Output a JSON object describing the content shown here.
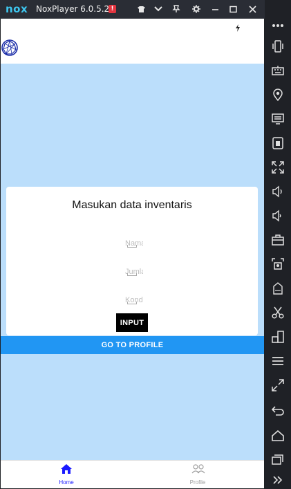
{
  "window": {
    "logo_text": "nox",
    "title": "NoxPlayer 6.0.5.2",
    "alert_badge": "!"
  },
  "titlebar_buttons": [
    {
      "name": "theme-icon"
    },
    {
      "name": "chevron-down-icon"
    },
    {
      "name": "pin-icon"
    },
    {
      "name": "gear-icon"
    },
    {
      "name": "minimize-icon"
    },
    {
      "name": "maximize-icon"
    },
    {
      "name": "close-icon"
    }
  ],
  "sidebar_buttons": [
    {
      "name": "more-icon"
    },
    {
      "name": "shake-icon"
    },
    {
      "name": "keyboard-icon"
    },
    {
      "name": "location-icon"
    },
    {
      "name": "screen-icon"
    },
    {
      "name": "apk-install-icon"
    },
    {
      "name": "fullscreen-icon"
    },
    {
      "name": "volume-up-icon"
    },
    {
      "name": "volume-down-icon"
    },
    {
      "name": "toolbox-icon"
    },
    {
      "name": "screenshot-icon"
    },
    {
      "name": "fps-icon"
    },
    {
      "name": "scissors-icon"
    },
    {
      "name": "multi-instance-icon"
    },
    {
      "name": "menu-icon"
    },
    {
      "name": "resize-icon"
    },
    {
      "name": "back-icon"
    },
    {
      "name": "home-icon"
    },
    {
      "name": "recent-apps-icon"
    },
    {
      "name": "expand-icon"
    }
  ],
  "form": {
    "title": "Masukan data inventaris",
    "fields": [
      {
        "placeholder": "Nama",
        "value": ""
      },
      {
        "placeholder": "Jumlah",
        "value": ""
      },
      {
        "placeholder": "Kondisi",
        "value": ""
      }
    ],
    "submit_label": "INPUT"
  },
  "profile_button": "GO TO PROFILE",
  "tabs": [
    {
      "label": "Home",
      "active": true
    },
    {
      "label": "Profile",
      "active": false
    }
  ],
  "colors": {
    "screen_bg": "#bbdefb",
    "primary": "#2196f3",
    "active_tab": "#1a1aff",
    "inactive_tab": "#9e9e9e"
  }
}
